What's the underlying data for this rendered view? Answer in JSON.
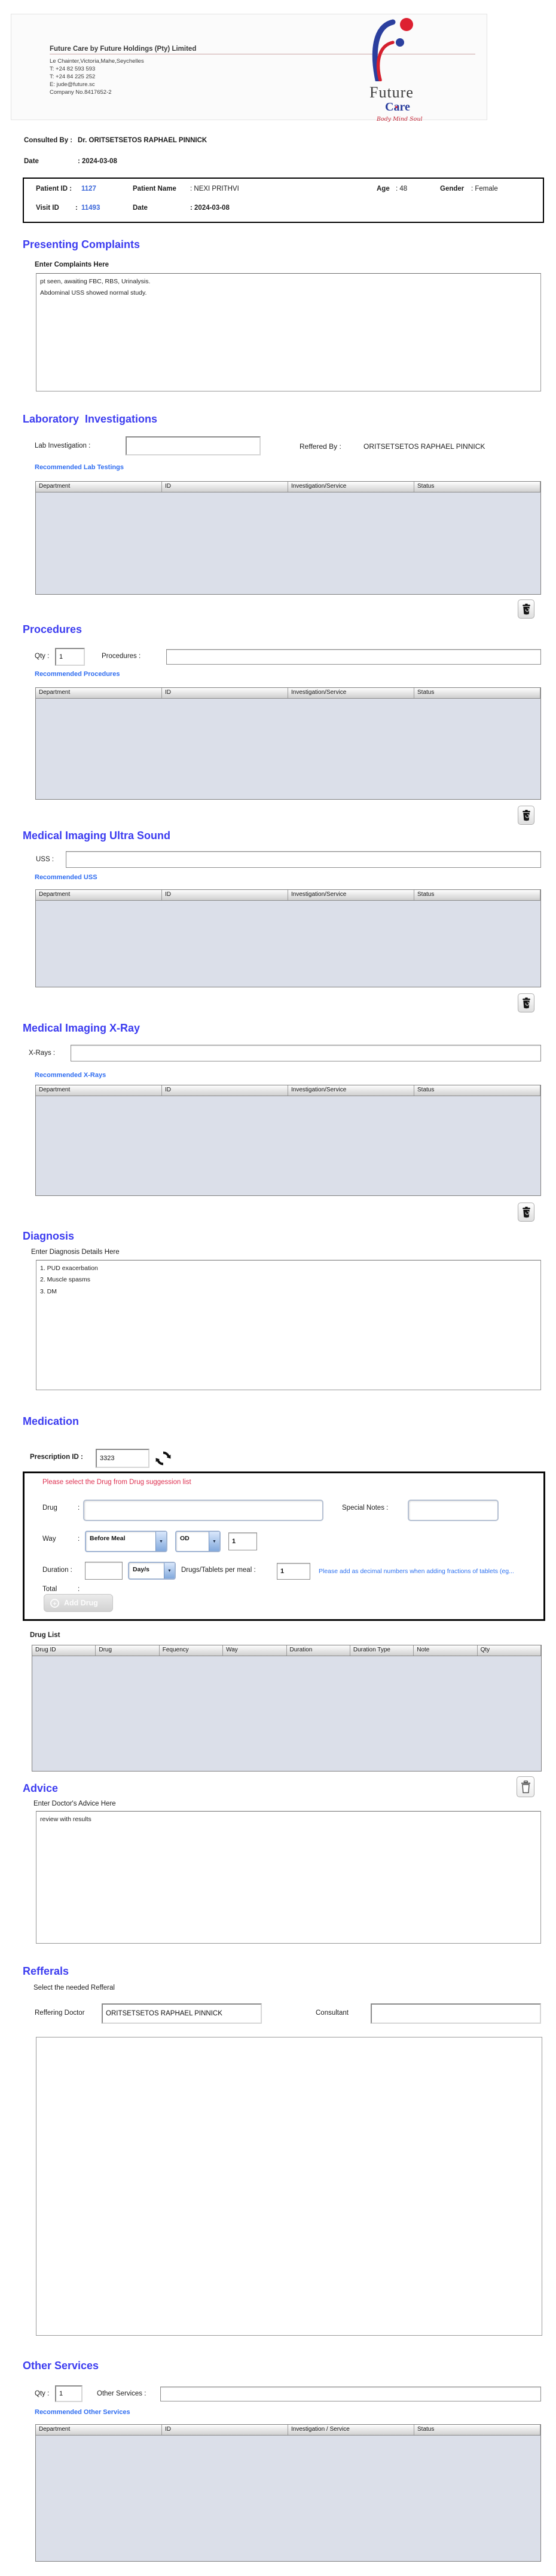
{
  "icons": {
    "dropdown_arrow": "▼",
    "plus": "+",
    "heart": "♥"
  },
  "header": {
    "company_name": "Future Care by Future Holdings (Pty) Limited",
    "address": "Le Chainter,Victoria,Mahe,Seychelles",
    "phone1": "T: +24  82 593 593",
    "phone2": "T: +24  84 225 252",
    "email": "E: jude@future.sc",
    "company_no": "Company No.8417652-2",
    "logo": {
      "word1": "Future",
      "word2_pre": "C",
      "word2_a": "a",
      "word2_post": "re",
      "tagline": "Body Mind Soul"
    }
  },
  "consult": {
    "consulted_by_label": "Consulted By :",
    "consulted_by_value": "Dr.  ORITSETSETOS RAPHAEL PINNICK",
    "date_label": "Date",
    "date_value": ": 2024-03-08"
  },
  "patient": {
    "id_label": "Patient ID :",
    "id_value": "1127",
    "name_label": "Patient Name",
    "name_value": ": NEXI PRITHVI",
    "age_label": "Age",
    "age_value": ": 48",
    "gender_label": "Gender",
    "gender_value": ": Female",
    "visit_label": "Visit ID",
    "visit_colon": ":",
    "visit_value": "11493",
    "date_label": "Date",
    "date_value": ": 2024-03-08"
  },
  "complaints": {
    "title": "Presenting Complaints",
    "label": "Enter Complaints Here",
    "text": "pt seen, awaiting FBC, RBS, Urinalysis.\nAbdominal USS showed normal study."
  },
  "lab": {
    "title": "Laboratory  Investigations",
    "field_label": "Lab Investigation :",
    "reffered_label": "Reffered By :",
    "reffered_value": "ORITSETSETOS RAPHAEL PINNICK",
    "recommended": "Recommended Lab Testings",
    "columns": [
      "Department",
      "ID",
      "Investigation/Service",
      "Status"
    ]
  },
  "procedures": {
    "title": "Procedures",
    "qty_label": "Qty :",
    "qty_value": "1",
    "field_label": "Procedures :",
    "recommended": "Recommended Procedures",
    "columns": [
      "Department",
      "ID",
      "Investigation/Service",
      "Status"
    ]
  },
  "uss": {
    "title": "Medical Imaging Ultra Sound",
    "field_label": "USS :",
    "recommended": "Recommended USS",
    "columns": [
      "Department",
      "ID",
      "Investigation/Service",
      "Status"
    ]
  },
  "xray": {
    "title": "Medical Imaging X-Ray",
    "field_label": "X-Rays :",
    "recommended": "Recommended X-Rays",
    "columns": [
      "Department",
      "ID",
      "Investigation/Service",
      "Status"
    ]
  },
  "diagnosis": {
    "title": "Diagnosis",
    "label": "Enter Diagnosis Details Here",
    "text": "1. PUD exacerbation\n2. Muscle spasms\n3. DM"
  },
  "medication": {
    "title": "Medication",
    "prescription_label": "Prescription ID :",
    "prescription_id": "3323",
    "warning": "Please select the Drug from Drug suggession list",
    "drug_label": "Drug",
    "drug_colon": ":",
    "special_notes_label": "Special Notes  :",
    "way_label": "Way",
    "way_colon": ":",
    "meal_option": "Before Meal",
    "freq_option": "OD",
    "way_qty": "1",
    "duration_label": "Duration :",
    "duration_unit": "Day/s",
    "per_meal_label": "Drugs/Tablets per meal :",
    "per_meal_value": "1",
    "note": "Please add as decimal numbers when adding fractions of tablets (eg...",
    "total_label": "Total",
    "total_colon": ":",
    "add_drug_label": "Add Drug",
    "drug_list_label": "Drug List",
    "columns": [
      "Drug ID",
      "Drug",
      "Fequency",
      "Way",
      "Duration",
      "Duration Type",
      "Note",
      "Qty"
    ]
  },
  "advice": {
    "title": "Advice",
    "label": "Enter Doctor's Advice Here",
    "text": "review with results"
  },
  "refferals": {
    "title": "Refferals",
    "subtitle": "Select the needed Refferal",
    "doctor_label": "Reffering Doctor",
    "doctor_value": "ORITSETSETOS RAPHAEL PINNICK",
    "consultant_label": "Consultant"
  },
  "other": {
    "title": "Other Services",
    "qty_label": "Qty :",
    "qty_value": "1",
    "field_label": "Other Services :",
    "recommended": "Recommended Other Services",
    "columns": [
      "Department",
      "ID",
      "Investigation / Service",
      "Status"
    ]
  }
}
